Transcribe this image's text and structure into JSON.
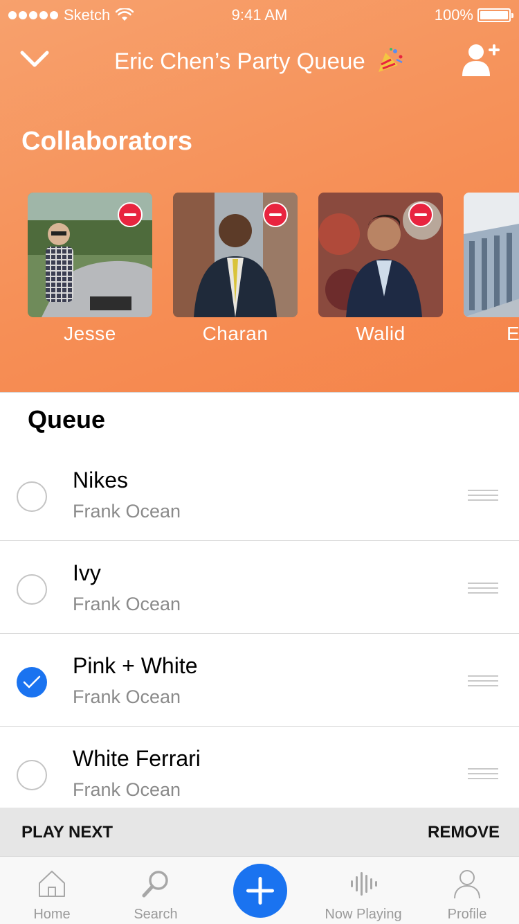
{
  "status_bar": {
    "carrier": "Sketch",
    "time": "9:41 AM",
    "battery": "100%",
    "battery_level": 1.0
  },
  "nav": {
    "title": "Eric Chen’s Party Queue",
    "back_icon": "chevron-down-icon",
    "add_icon": "add-user-icon"
  },
  "collaborators": {
    "title": "Collaborators",
    "items": [
      {
        "name": "Jesse",
        "photo": "photo-jesse"
      },
      {
        "name": "Charan",
        "photo": "photo-charan"
      },
      {
        "name": "Walid",
        "photo": "photo-walid"
      },
      {
        "name": "Edw",
        "photo": "photo-building"
      }
    ]
  },
  "queue": {
    "title": "Queue",
    "songs": [
      {
        "title": "Nikes",
        "artist": "Frank Ocean",
        "selected": false
      },
      {
        "title": "Ivy",
        "artist": "Frank Ocean",
        "selected": false
      },
      {
        "title": "Pink + White",
        "artist": "Frank Ocean",
        "selected": true
      },
      {
        "title": "White Ferrari",
        "artist": "Frank Ocean",
        "selected": false
      }
    ]
  },
  "actions": {
    "play_next": "PLAY NEXT",
    "remove": "REMOVE"
  },
  "tabs": {
    "home": "Home",
    "search": "Search",
    "now_playing": "Now Playing",
    "profile": "Profile"
  },
  "colors": {
    "header_orange": "#f68e55",
    "accent_blue": "#1a73f0",
    "remove_red": "#e8243f"
  }
}
